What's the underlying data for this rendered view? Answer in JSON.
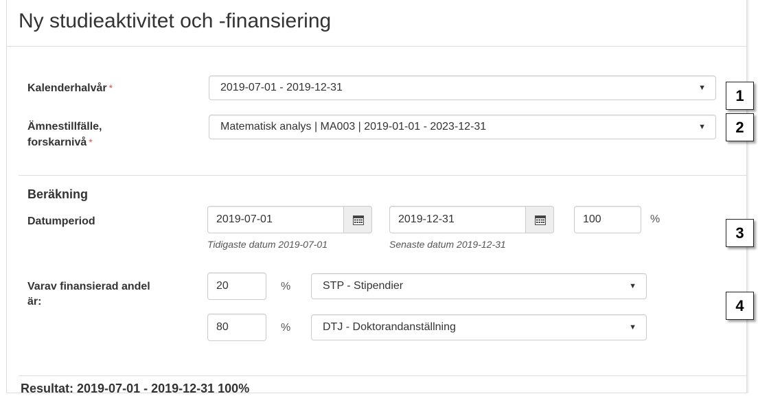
{
  "header": {
    "title": "Ny studieaktivitet och -finansiering"
  },
  "form": {
    "kalender": {
      "label": "Kalenderhalvår",
      "required_mark": "*",
      "value": "2019-07-01 - 2019-12-31",
      "caret": "▼"
    },
    "amne": {
      "label_line1": "Ämnestillfälle,",
      "label_line2": "forskarnivå",
      "required_mark": "*",
      "value": "Matematisk analys | MA003 | 2019-01-01 - 2023-12-31",
      "caret": "▼"
    },
    "berakning": {
      "title": "Beräkning",
      "datumperiod_label": "Datumperiod",
      "start_value": "2019-07-01",
      "start_hint": "Tidigaste datum 2019-07-01",
      "end_value": "2019-12-31",
      "end_hint": "Senaste datum 2019-12-31",
      "percent_value": "100",
      "percent_sign": "%"
    },
    "finansiering": {
      "label_line1": "Varav finansierad andel",
      "label_line2": "är:",
      "rows": [
        {
          "percent": "20",
          "percent_sign": "%",
          "type": "STP - Stipendier",
          "caret": "▼"
        },
        {
          "percent": "80",
          "percent_sign": "%",
          "type": "DTJ - Doktorandanställning",
          "caret": "▼"
        }
      ]
    },
    "result": "Resultat: 2019-07-01 - 2019-12-31 100%"
  },
  "callouts": [
    "1",
    "2",
    "3",
    "4"
  ],
  "colors": {
    "required": "#d9534f",
    "border": "#cccccc",
    "addon_bg": "#eeeeee"
  },
  "icons": {
    "calendar": "calendar-icon",
    "caret": "caret-down-icon"
  }
}
